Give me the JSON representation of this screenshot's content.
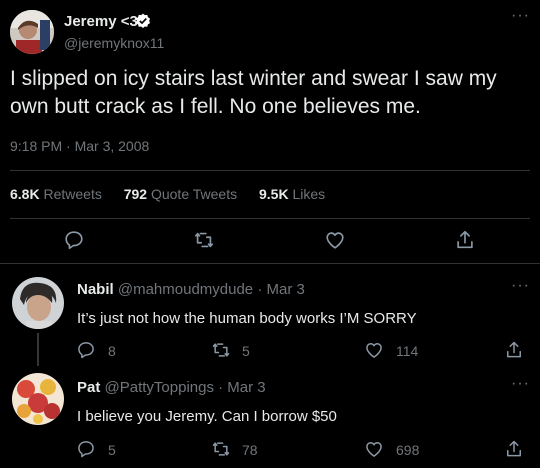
{
  "tweet": {
    "author_name": "Jeremy <3",
    "handle": "@jeremyknox11",
    "text": "I slipped on icy stairs last winter and swear I saw my own butt crack as I fell. No one believes me.",
    "timestamp": "9:18 PM · Mar 3, 2008",
    "stats": {
      "retweets_count": "6.8K",
      "retweets_label": "Retweets",
      "quotes_count": "792",
      "quotes_label": "Quote Tweets",
      "likes_count": "9.5K",
      "likes_label": "Likes"
    }
  },
  "replies": [
    {
      "name": "Nabil",
      "meta": "@mahmoudmydude · Mar 3",
      "text": "It’s just not how the human body works I’M SORRY",
      "replies": "8",
      "retweets": "5",
      "likes": "114"
    },
    {
      "name": "Pat",
      "meta": "@PattyToppings · Mar 3",
      "text": "I believe you Jeremy. Can I borrow $50",
      "replies": "5",
      "retweets": "78",
      "likes": "698"
    }
  ],
  "colors": {
    "background": "#000000",
    "text": "#e7e9ea",
    "muted": "#71767b",
    "divider": "#2f3336",
    "verified": "#ffffff"
  },
  "icons": [
    "more-icon",
    "verified-icon",
    "reply-icon",
    "retweet-icon",
    "like-icon",
    "share-icon"
  ]
}
